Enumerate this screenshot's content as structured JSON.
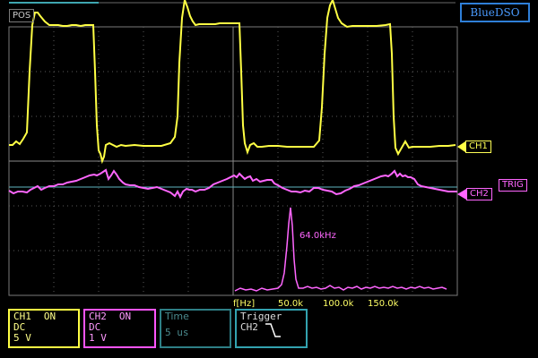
{
  "window": {
    "brand": "BlueDSO",
    "pos_label": "POS"
  },
  "channels": {
    "ch1": {
      "marker": "CH1",
      "name": "CH1",
      "state": "ON",
      "coupling": "DC",
      "scale": "5 V",
      "color": "#ffff44"
    },
    "ch2": {
      "marker": "CH2",
      "name": "CH2",
      "state": "ON",
      "coupling": "DC",
      "scale": "1 V",
      "color": "#ff66ff"
    }
  },
  "trigger_marker": "TRIG",
  "timebase": {
    "label": "Time",
    "value": "5 us"
  },
  "trigger": {
    "label": "Trigger",
    "source": "CH2",
    "edge_icon": "falling-edge-icon"
  },
  "fft": {
    "unit_label": "f[Hz]",
    "ticks": [
      "50.0k",
      "100.0k",
      "150.0k"
    ],
    "peak_label": "64.0kHz"
  },
  "colors": {
    "grid": "#5a5a5a",
    "ch1": "#ffff44",
    "ch2": "#ff66ff",
    "brand": "#2f7fd8",
    "time_panel": "#2e7f86",
    "trigger_panel": "#33a3b0"
  }
}
